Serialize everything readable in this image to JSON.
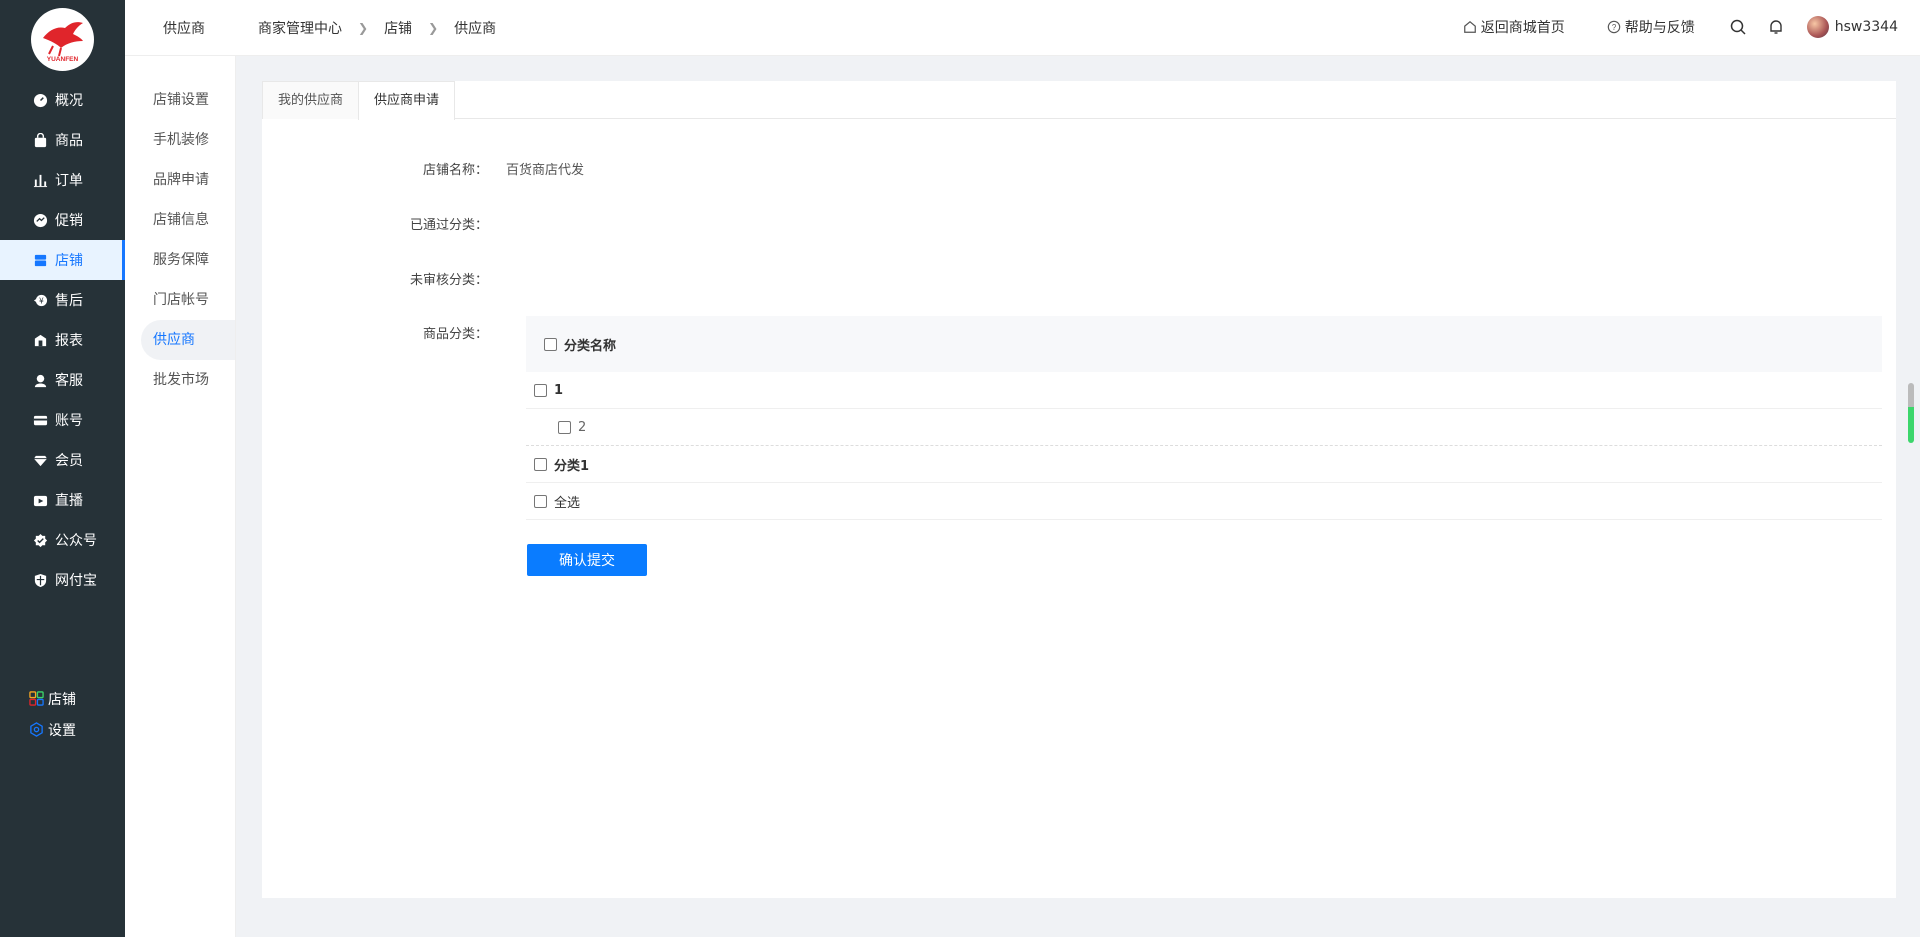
{
  "brand": {
    "logo_text": "YUANFEN"
  },
  "sidebar": {
    "items": [
      {
        "label": "概况",
        "icon": "gauge-icon"
      },
      {
        "label": "商品",
        "icon": "bag-icon"
      },
      {
        "label": "订单",
        "icon": "bar-chart-icon"
      },
      {
        "label": "促销",
        "icon": "promo-icon"
      },
      {
        "label": "店铺",
        "icon": "store-icon",
        "active": true
      },
      {
        "label": "售后",
        "icon": "after-sale-icon"
      },
      {
        "label": "报表",
        "icon": "report-icon"
      },
      {
        "label": "客服",
        "icon": "service-icon"
      },
      {
        "label": "账号",
        "icon": "card-icon"
      },
      {
        "label": "会员",
        "icon": "diamond-icon"
      },
      {
        "label": "直播",
        "icon": "live-icon"
      },
      {
        "label": "公众号",
        "icon": "badge-check-icon"
      },
      {
        "label": "网付宝",
        "icon": "shield-icon"
      }
    ],
    "bottom": [
      {
        "label": "店铺",
        "icon": "grid-icon"
      },
      {
        "label": "设置",
        "icon": "hex-settings-icon"
      }
    ]
  },
  "submenu": {
    "items": [
      "店铺设置",
      "手机装修",
      "品牌申请",
      "店铺信息",
      "服务保障",
      "门店帐号",
      "供应商",
      "批发市场"
    ],
    "active_index": 6
  },
  "topbar": {
    "title": "供应商",
    "breadcrumb": [
      "商家管理中心",
      "店铺",
      "供应商"
    ],
    "home_link": "返回商城首页",
    "help_link": "帮助与反馈",
    "username": "hsw3344"
  },
  "tabs": [
    {
      "label": "我的供应商",
      "active": false
    },
    {
      "label": "供应商申请",
      "active": true
    }
  ],
  "form": {
    "store_name_label": "店铺名称：",
    "store_name_value": "百货商店代发",
    "approved_label": "已通过分类：",
    "approved_value": "",
    "pending_label": "未审核分类：",
    "pending_value": "",
    "category_label": "商品分类："
  },
  "category_table": {
    "header": "分类名称",
    "rows": [
      {
        "label": "1",
        "level": 1
      },
      {
        "label": "2",
        "level": 2
      },
      {
        "label": "分类1",
        "level": 1
      }
    ],
    "select_all": "全选"
  },
  "submit_label": "确认提交",
  "colors": {
    "accent": "#1677ff",
    "sidebar_bg": "#263238",
    "button": "#0a7cff"
  }
}
